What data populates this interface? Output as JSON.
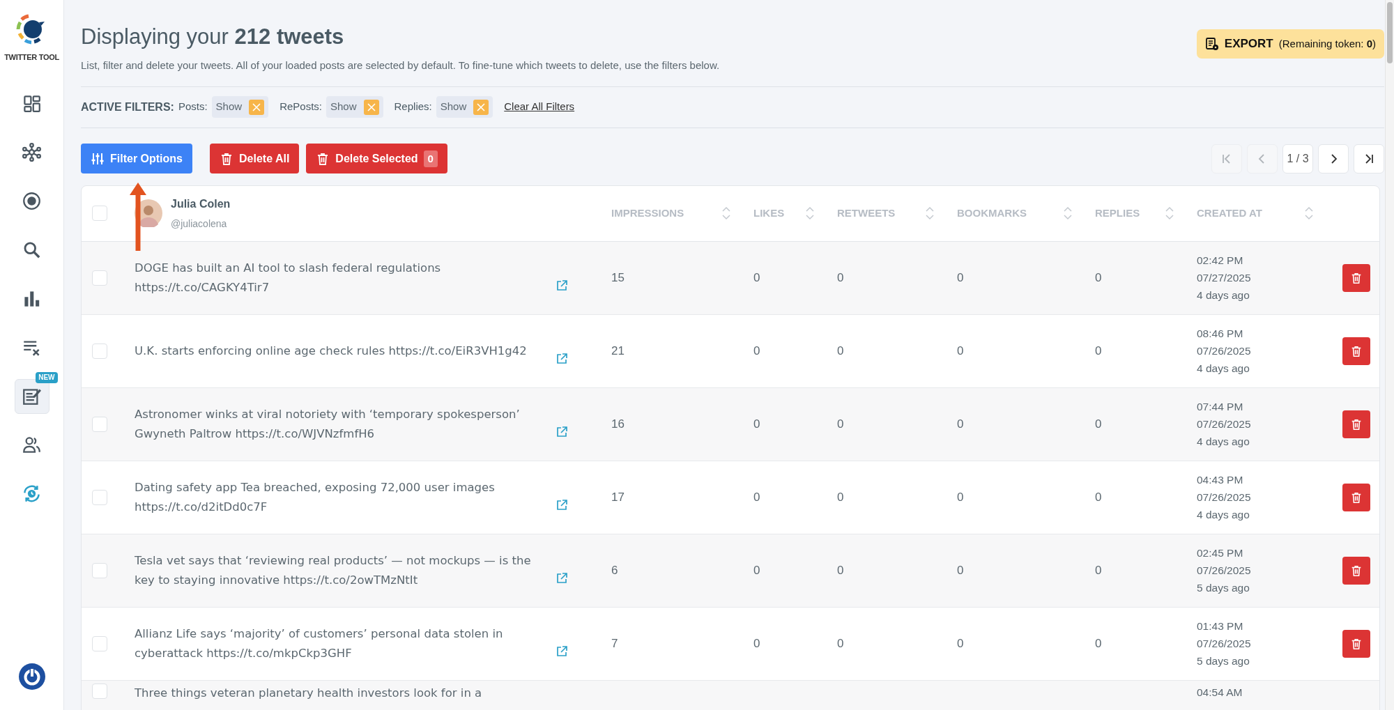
{
  "sidebar": {
    "logo_text": "TWITTER TOOL",
    "items": [
      {
        "kind": "dashboard",
        "selected": false
      },
      {
        "kind": "network",
        "selected": false
      },
      {
        "kind": "target",
        "selected": false
      },
      {
        "kind": "search",
        "selected": false
      },
      {
        "kind": "chart",
        "selected": false
      },
      {
        "kind": "list-remove",
        "selected": false
      },
      {
        "kind": "note",
        "selected": true,
        "badge": "NEW"
      },
      {
        "kind": "users",
        "selected": false
      },
      {
        "kind": "sync",
        "selected": false
      }
    ]
  },
  "header": {
    "title": "Displaying your **212 tweets**",
    "subtitle": "List, filter and delete your tweets. All of your loaded posts are selected by default. To fine-tune which tweets to delete, use the filters below.",
    "export": {
      "label": "EXPORT",
      "note": "(Remaining token: **0**)"
    }
  },
  "filters": {
    "label": "ACTIVE FILTERS:",
    "items": [
      {
        "label": "Posts:",
        "value": "Show"
      },
      {
        "label": "RePosts:",
        "value": "Show"
      },
      {
        "label": "Replies:",
        "value": "Show"
      }
    ],
    "clear": "Clear All Filters"
  },
  "toolbar": {
    "filter_button": "Filter Options",
    "delete_all": "Delete All",
    "delete_selected": {
      "label": "Delete Selected",
      "count": "0"
    },
    "pagination": {
      "page": "1 / 3",
      "first_disabled": true,
      "prev_disabled": true,
      "next_disabled": false,
      "last_disabled": false
    }
  },
  "table": {
    "select_all_checked": false,
    "account": {
      "name": "Julia Colen",
      "handle": "@juliacolena"
    },
    "columns": [
      "IMPRESSIONS",
      "LIKES",
      "RETWEETS",
      "BOOKMARKS",
      "REPLIES",
      "CREATED AT"
    ],
    "rows": [
      {
        "checked": false,
        "text": "DOGE has built an AI tool to slash federal regulations https://t.co/CAGKY4Tir7",
        "impressions": "15",
        "likes": "0",
        "retweets": "0",
        "bookmarks": "0",
        "replies": "0",
        "time": "02:42 PM",
        "date": "07/27/2025",
        "ago": "4 days ago"
      },
      {
        "checked": false,
        "text": "U.K. starts enforcing online age check rules https://t.co/EiR3VH1g42",
        "impressions": "21",
        "likes": "0",
        "retweets": "0",
        "bookmarks": "0",
        "replies": "0",
        "time": "08:46 PM",
        "date": "07/26/2025",
        "ago": "4 days ago"
      },
      {
        "checked": false,
        "text": "Astronomer winks at viral notoriety with ‘temporary spokesperson’ Gwyneth Paltrow https://t.co/WJVNzfmfH6",
        "impressions": "16",
        "likes": "0",
        "retweets": "0",
        "bookmarks": "0",
        "replies": "0",
        "time": "07:44 PM",
        "date": "07/26/2025",
        "ago": "4 days ago"
      },
      {
        "checked": false,
        "text": "Dating safety app Tea breached, exposing 72,000 user images https://t.co/d2itDd0c7F",
        "impressions": "17",
        "likes": "0",
        "retweets": "0",
        "bookmarks": "0",
        "replies": "0",
        "time": "04:43 PM",
        "date": "07/26/2025",
        "ago": "4 days ago"
      },
      {
        "checked": false,
        "text": "Tesla vet says that ‘reviewing real products’ — not mockups — is the key to staying innovative https://t.co/2owTMzNtIt",
        "impressions": "6",
        "likes": "0",
        "retweets": "0",
        "bookmarks": "0",
        "replies": "0",
        "time": "02:45 PM",
        "date": "07/26/2025",
        "ago": "5 days ago"
      },
      {
        "checked": false,
        "text": "Allianz Life says ‘majority’ of customers’ personal data stolen in cyberattack https://t.co/mkpCkp3GHF",
        "impressions": "7",
        "likes": "0",
        "retweets": "0",
        "bookmarks": "0",
        "replies": "0",
        "time": "01:43 PM",
        "date": "07/26/2025",
        "ago": "5 days ago"
      },
      {
        "checked": false,
        "text": "Three things veteran planetary health investors look for in a",
        "time": "04:54 AM"
      }
    ]
  }
}
